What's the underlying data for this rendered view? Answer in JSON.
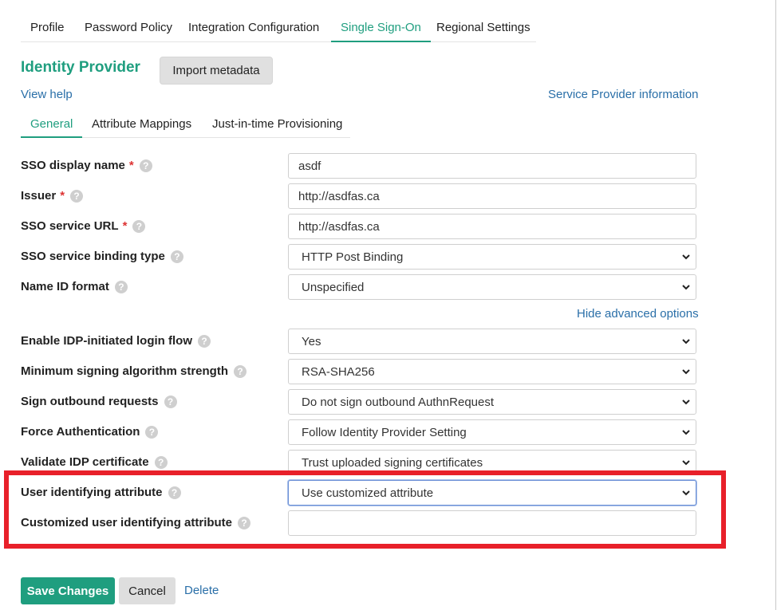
{
  "top_tabs": [
    "Profile",
    "Password Policy",
    "Integration Configuration",
    "Single Sign-On",
    "Regional Settings"
  ],
  "title": "Identity Provider",
  "import_button": "Import metadata",
  "view_help": "View help",
  "service_provider_info": "Service Provider information",
  "sub_tabs": [
    "General",
    "Attribute Mappings",
    "Just-in-time Provisioning"
  ],
  "fields": {
    "sso_display_name": {
      "label": "SSO display name",
      "value": "asdf"
    },
    "issuer": {
      "label": "Issuer",
      "value": "http://asdfas.ca"
    },
    "sso_service_url": {
      "label": "SSO service URL",
      "value": "http://asdfas.ca"
    },
    "sso_binding": {
      "label": "SSO service binding type",
      "value": "HTTP Post Binding"
    },
    "name_id_format": {
      "label": "Name ID format",
      "value": "Unspecified"
    },
    "idp_initiated": {
      "label": "Enable IDP-initiated login flow",
      "value": "Yes"
    },
    "min_signing": {
      "label": "Minimum signing algorithm strength",
      "value": "RSA-SHA256"
    },
    "sign_outbound": {
      "label": "Sign outbound requests",
      "value": "Do not sign outbound AuthnRequest"
    },
    "force_auth": {
      "label": "Force Authentication",
      "value": "Follow Identity Provider Setting"
    },
    "validate_cert": {
      "label": "Validate IDP certificate",
      "value": "Trust uploaded signing certificates"
    },
    "user_ident": {
      "label": "User identifying attribute",
      "value": "Use customized attribute"
    },
    "custom_user_ident": {
      "label": "Customized user identifying attribute",
      "value": ""
    }
  },
  "required_mark": "*",
  "help_glyph": "?",
  "hide_advanced": "Hide advanced options",
  "save_button": "Save Changes",
  "cancel_button": "Cancel",
  "delete_link": "Delete",
  "colors": {
    "accent": "#1f9e7f",
    "link": "#2a6fa8",
    "highlight": "#e8202a"
  }
}
